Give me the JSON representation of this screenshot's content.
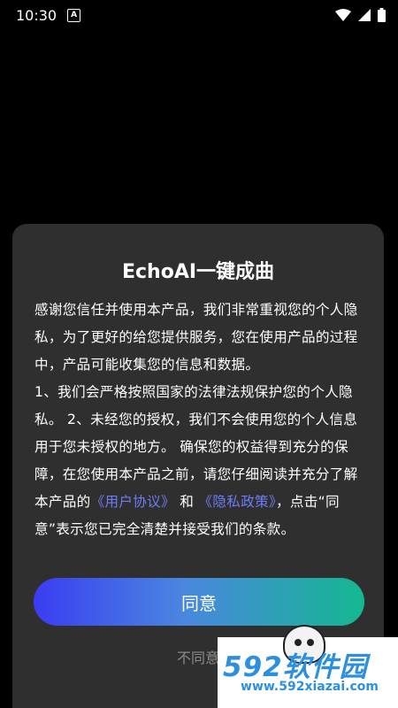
{
  "status_bar": {
    "time": "10:30",
    "notification_icon": "a-icon",
    "icons": [
      "wifi-icon",
      "signal-icon",
      "battery-icon"
    ]
  },
  "dialog": {
    "title": "EchoAI一键成曲",
    "body_part1": "感谢您信任并使用本产品，我们非常重视您的个人隐私，为了更好的给您提供服务，您在使用产品的过程中，产品可能收集您的信息和数据。",
    "body_part2": "1、我们会严格按照国家的法律法规保护您的个人隐私。 2、未经您的授权，我们不会使用您的个人信息用于您未授权的地方。 确保您的权益得到充分的保障，在您使用本产品之前，请您仔细阅读并充分了解本产品的",
    "link_user_agreement": "《用户协议》",
    "and_text": "和",
    "link_privacy_policy": "《隐私政策》",
    "body_part3": "，点击“同意”表示您已完全清楚并接受我们的条款。",
    "agree_label": "同意",
    "disagree_label": "不同意"
  },
  "watermark": {
    "brand": "592软件园",
    "url": "www.592xiazai.com"
  },
  "colors": {
    "dialog_bg": "#2f2f2f",
    "link": "#6f7cf6",
    "button_gradient_start": "#3a3df2",
    "button_gradient_end": "#14b890"
  }
}
